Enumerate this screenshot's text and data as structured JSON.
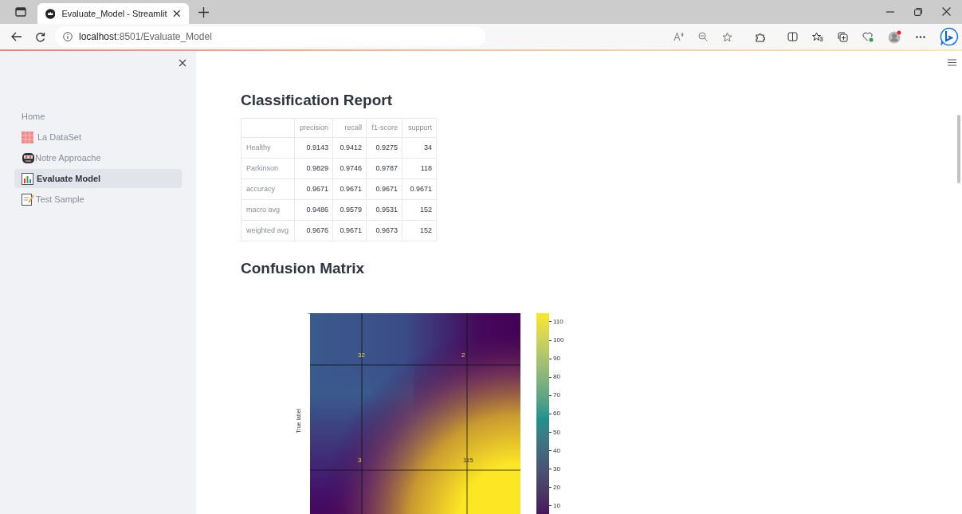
{
  "browser": {
    "tab_title": "Evaluate_Model - Streamlit",
    "url_host": "localhost",
    "url_path": ":8501/Evaluate_Model"
  },
  "sidebar": {
    "items": [
      {
        "label": "Home",
        "kind": "plain",
        "selected": false
      },
      {
        "label": "La DataSet",
        "kind": "grid",
        "selected": false
      },
      {
        "label": "Notre Approache",
        "kind": "robot",
        "selected": false
      },
      {
        "label": "Evaluate Model",
        "kind": "chart",
        "selected": true
      },
      {
        "label": "Test Sample",
        "kind": "memo",
        "selected": false
      }
    ]
  },
  "report": {
    "title": "Classification Report",
    "columns": [
      "precision",
      "recall",
      "f1-score",
      "support"
    ],
    "rows": [
      {
        "label": "Healthy",
        "cells": [
          "0.9143",
          "0.9412",
          "0.9275",
          "34"
        ]
      },
      {
        "label": "Parkinson",
        "cells": [
          "0.9829",
          "0.9746",
          "0.9787",
          "118"
        ]
      },
      {
        "label": "accuracy",
        "cells": [
          "0.9671",
          "0.9671",
          "0.9671",
          "0.9671"
        ]
      },
      {
        "label": "macro avg",
        "cells": [
          "0.9486",
          "0.9579",
          "0.9531",
          "152"
        ]
      },
      {
        "label": "weighted avg",
        "cells": [
          "0.9676",
          "0.9671",
          "0.9673",
          "152"
        ]
      }
    ]
  },
  "confusion": {
    "title": "Confusion Matrix",
    "ylabel": "True label",
    "cells": [
      "32",
      "2",
      "3",
      "115"
    ],
    "colorbar_ticks": [
      "110",
      "100",
      "90",
      "80",
      "70",
      "60",
      "50",
      "40",
      "30",
      "20",
      "10"
    ]
  }
}
